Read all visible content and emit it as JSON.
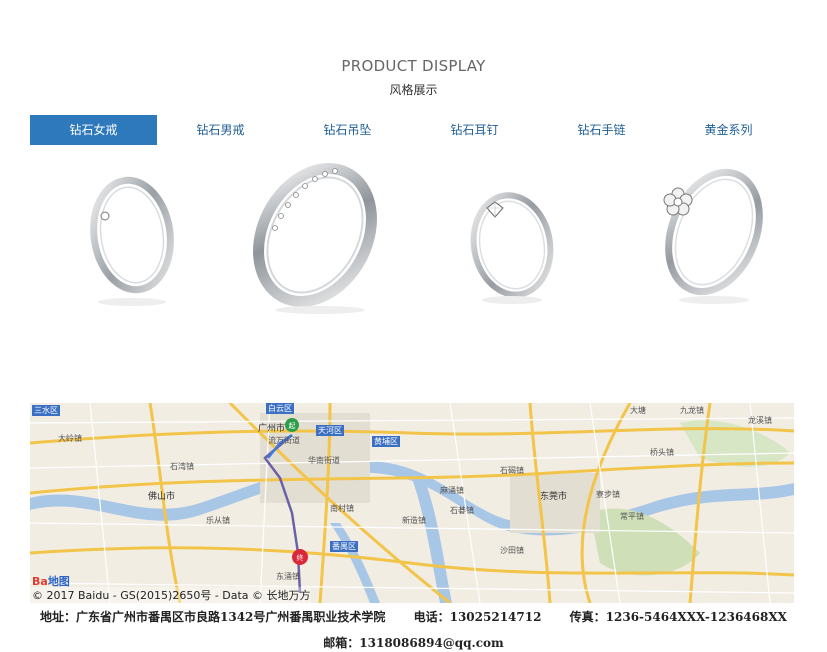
{
  "section": {
    "title_en": "PRODUCT DISPLAY",
    "title_cn": "风格展示"
  },
  "tabs": [
    {
      "label": "钻石女戒",
      "active": true
    },
    {
      "label": "钻石男戒",
      "active": false
    },
    {
      "label": "钻石吊坠",
      "active": false
    },
    {
      "label": "钻石耳钉",
      "active": false
    },
    {
      "label": "钻石手链",
      "active": false
    },
    {
      "label": "黄金系列",
      "active": false
    }
  ],
  "products": [
    {
      "icon": "diamond-ring-icon"
    },
    {
      "icon": "pave-band-ring-icon"
    },
    {
      "icon": "solitaire-ring-icon"
    },
    {
      "icon": "flower-ring-icon"
    }
  ],
  "map": {
    "copyright": "© 2017 Baidu - GS(2015)2650号 - Data © 长地万方",
    "logo_left": "Ba",
    "logo_right": "地图",
    "labels": {
      "sanshui": "三水区",
      "baiyun": "白云区",
      "guangzhou": "广州市",
      "liwan": "流万街道",
      "tianhe": "天河区",
      "huangpu": "黄埔区",
      "dalang": "大塘",
      "foshan": "佛山市",
      "dongguan": "东莞市",
      "panyu": "番禺区",
      "dalong": "大岭镇",
      "jiulong": "九龙镇",
      "longxi": "龙溪镇",
      "shiwan": "石湾镇",
      "huadu": "华南街道",
      "nancun": "南村镇",
      "shiji": "石碁镇",
      "xinzao": "新造镇",
      "liaobu": "寮步镇",
      "changping": "常平镇",
      "qiaotou": "桥头镇",
      "shijie": "石碣镇",
      "lecong": "乐从镇",
      "dongyong": "东涌镇",
      "mayong": "麻涌镇",
      "shatian": "沙田镇"
    }
  },
  "footer": {
    "address": "地址：广东省广州市番禺区市良路1342号广州番禺职业技术学院",
    "phone": "电话：13025214712",
    "fax": "传真：1236-5464XXX-1236468XX",
    "email": "邮箱：1318086894@qq.com"
  }
}
